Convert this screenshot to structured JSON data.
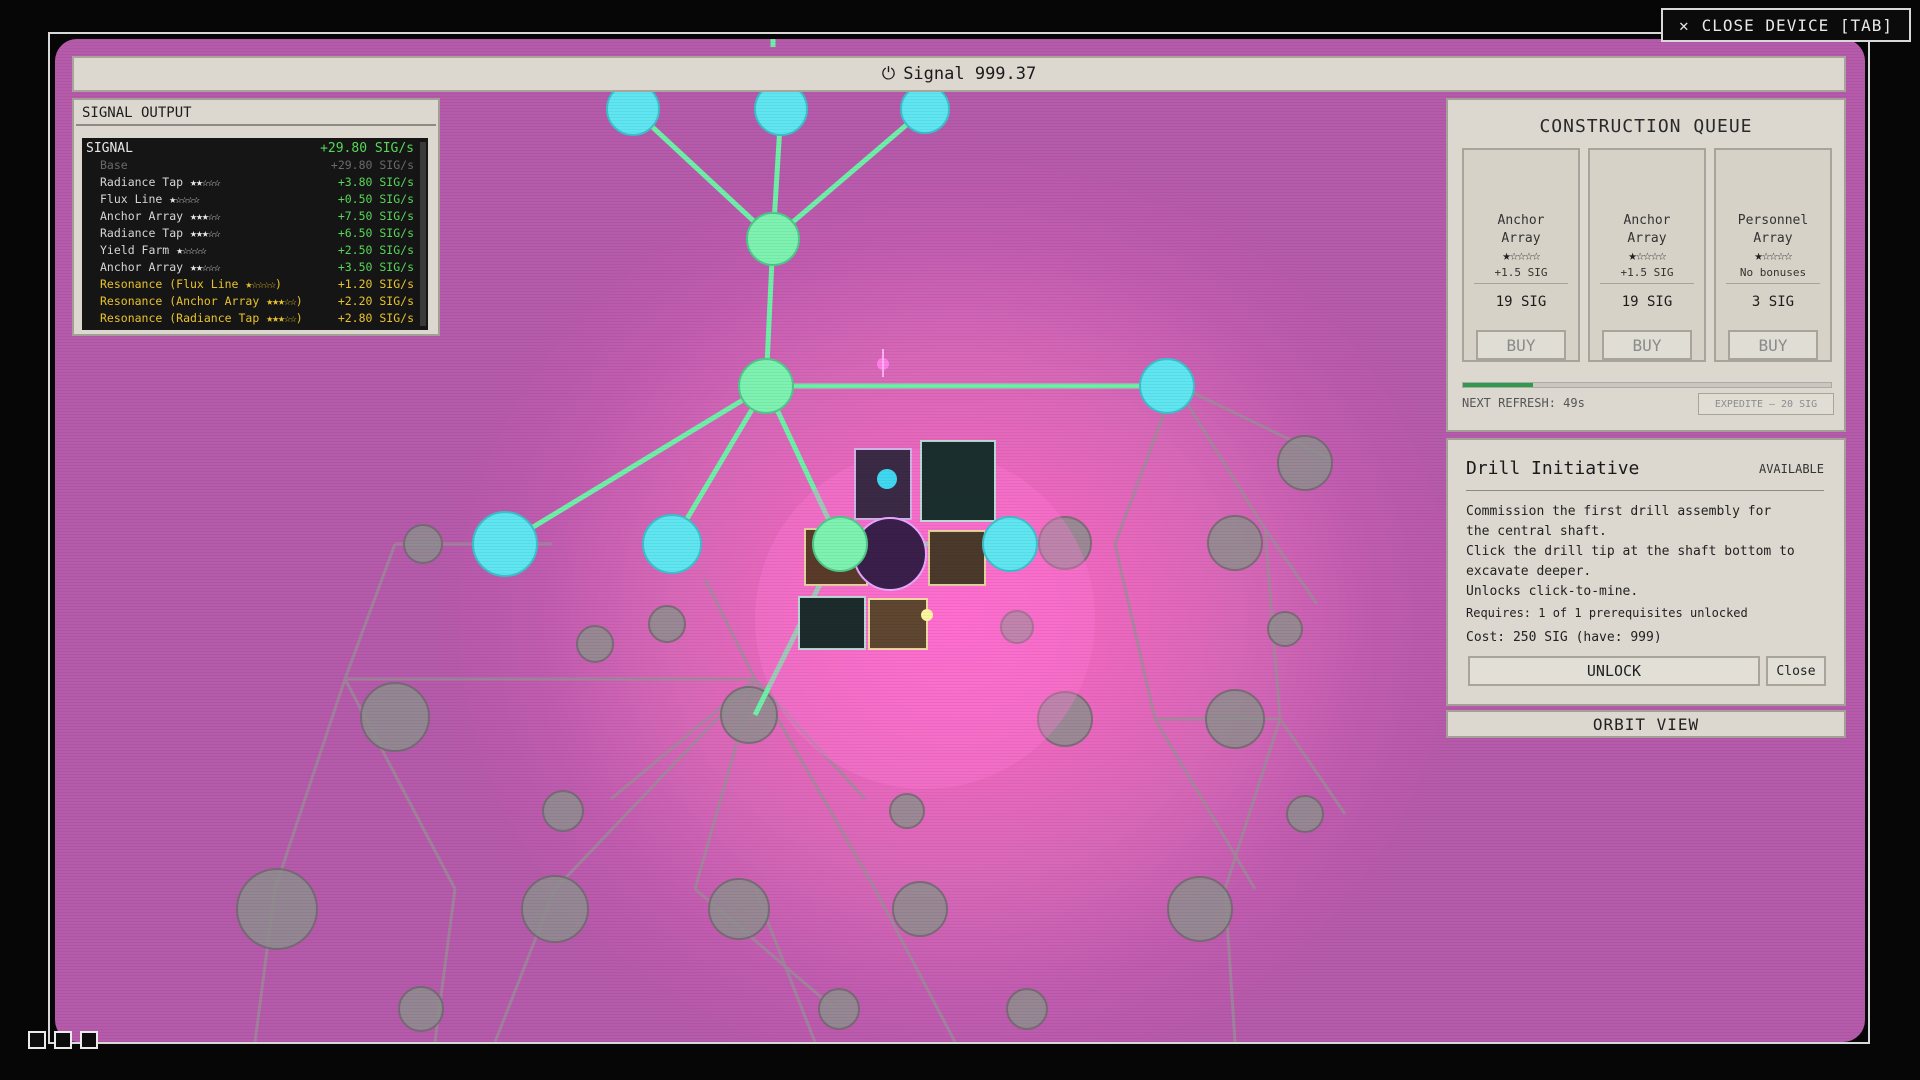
{
  "close_device": {
    "icon": "x-icon",
    "label": "CLOSE DEVICE [TAB]"
  },
  "signal_bar": {
    "icon": "power-icon",
    "label": "Signal 999.37"
  },
  "signal_output": {
    "title": "SIGNAL OUTPUT",
    "total": {
      "name": "SIGNAL",
      "value": "+29.80 SIG/s"
    },
    "rows": [
      {
        "name": "Base",
        "stars": "",
        "value": "+29.80 SIG/s",
        "style": "dim"
      },
      {
        "name": "Radiance Tap",
        "stars": "★★☆☆☆",
        "value": "+3.80 SIG/s",
        "style": "normal"
      },
      {
        "name": "Flux Line",
        "stars": "★☆☆☆☆",
        "value": "+0.50 SIG/s",
        "style": "normal"
      },
      {
        "name": "Anchor Array",
        "stars": "★★★☆☆",
        "value": "+7.50 SIG/s",
        "style": "normal"
      },
      {
        "name": "Radiance Tap",
        "stars": "★★★☆☆",
        "value": "+6.50 SIG/s",
        "style": "normal"
      },
      {
        "name": "Yield Farm",
        "stars": "★☆☆☆☆",
        "value": "+2.50 SIG/s",
        "style": "normal"
      },
      {
        "name": "Anchor Array",
        "stars": "★★☆☆☆",
        "value": "+3.50 SIG/s",
        "style": "normal"
      },
      {
        "name": "Resonance (Flux Line",
        "stars": "★☆☆☆☆)",
        "value": "+1.20 SIG/s",
        "style": "res"
      },
      {
        "name": "Resonance (Anchor Array",
        "stars": "★★★☆☆)",
        "value": "+2.20 SIG/s",
        "style": "res"
      },
      {
        "name": "Resonance (Radiance Tap",
        "stars": "★★★☆☆)",
        "value": "+2.80 SIG/s",
        "style": "res"
      }
    ]
  },
  "construction_queue": {
    "title": "CONSTRUCTION QUEUE",
    "cards": [
      {
        "name_line1": "Anchor",
        "name_line2": "Array",
        "stars": "★☆☆☆☆",
        "bonus": "+1.5 SIG",
        "price": "19 SIG",
        "buy_label": "BUY"
      },
      {
        "name_line1": "Anchor",
        "name_line2": "Array",
        "stars": "★☆☆☆☆",
        "bonus": "+1.5 SIG",
        "price": "19 SIG",
        "buy_label": "BUY"
      },
      {
        "name_line1": "Personnel",
        "name_line2": "Array",
        "stars": "★☆☆☆☆",
        "bonus": "No bonuses",
        "price": "3 SIG",
        "buy_label": "BUY"
      }
    ],
    "refresh_progress": 0.19,
    "next_refresh": "NEXT REFRESH: 49s",
    "expedite_label": "EXPEDITE — 20 SIG"
  },
  "detail": {
    "title": "Drill Initiative",
    "status": "AVAILABLE",
    "desc_lines": [
      "Commission the first drill assembly for",
      "the central shaft.",
      "Click the drill tip at the shaft bottom to",
      "excavate deeper.",
      "Unlocks click-to-mine."
    ],
    "requires": "Requires: 1 of 1 prerequisites unlocked",
    "cost": "Cost: 250 SIG  (have: 999)",
    "unlock_label": "UNLOCK",
    "close_label": "Close"
  },
  "orbit_view": {
    "label": "ORBIT VIEW"
  },
  "window_buttons": [
    "window-1",
    "window-2",
    "window-3"
  ],
  "colors": {
    "active_link": "#6ff0a8",
    "active_node": "#7ef2b0",
    "endpoint_node": "#5fe6f0",
    "locked_node": "#8f8f8f",
    "background_glow": "#ff66cc",
    "signal_green": "#58d658",
    "resonance_gold": "#e8c22c"
  }
}
